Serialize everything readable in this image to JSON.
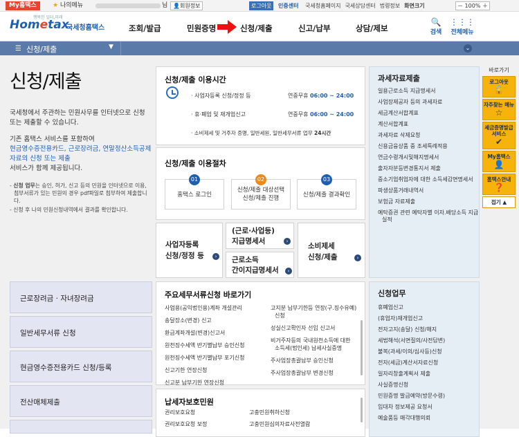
{
  "topbar": {
    "myhome": "My홈택스",
    "mymenu": "나의메뉴",
    "nim": "님",
    "userinfo": "회원정보",
    "logout": "로그아웃",
    "cert": "인증센터",
    "links": [
      "국세청홈페이지",
      "국세상담센터",
      "법령정보",
      "화면크기"
    ],
    "zoom": "100%"
  },
  "header": {
    "slogan": "행복한 일터,미래",
    "logo_pre": "Hom",
    "logo_e": "e",
    "logo_post": "tax",
    "logo_nts": "국세청홈택스",
    "nav": [
      "조회/발급",
      "민원증명",
      "신청/제출",
      "신고/납부",
      "상담/제보"
    ],
    "search": "검색",
    "allmenu": "전체메뉴"
  },
  "subbar": {
    "title": "신청/제출"
  },
  "intro": {
    "title": "신청/제출",
    "p1": "국세청에서 주관하는 민원사무를 인터넷으로 신청 또는 제출할 수 있습니다.",
    "p2a": "기존 홈택스 서비스를 포함하여",
    "p2b": "현금영수증전용카드, 근로장려금, 연말정산소득공제자료의 신청 또는 제출",
    "p2c": "서비스가 함께 제공됩니다.",
    "note1_b": "신청 업무",
    "note1": "는 승인, 허가, 신고 등의 민원을 인터넷으로 이용, 첨부서류가 있는 민원의 경우 pdf파일로 첨부하여 제출합니다.",
    "note2": "신청 후 나의 민원신청내역에서 결과를 확인합니다."
  },
  "hours": {
    "title": "신청/제출 이용시간",
    "rows": [
      {
        "label": "· 사업자등록 신청/정정 등",
        "range": "연중무휴",
        "time": "06:00 ~ 24:00"
      },
      {
        "label": "· 휴·폐업 및 재개업신고",
        "range": "연중무휴",
        "time": "06:00 ~ 24:00"
      },
      {
        "label": "· 소비제세 및 거주자 증명, 일반세원, 일반세무서류 업무",
        "range": "",
        "time": "24시간"
      }
    ]
  },
  "procedure": {
    "title": "신청/제출 이용절차",
    "steps": [
      {
        "num": "01",
        "l1": "홈택스 로그인",
        "l2": ""
      },
      {
        "num": "02",
        "l1": "신청/제출 대상선택",
        "l2": "신청/제출 진행"
      },
      {
        "num": "03",
        "l1": "신청/제출 결과확인",
        "l2": ""
      }
    ]
  },
  "boxes": {
    "biz_l1": "사업자등록",
    "biz_l2": "신청/정정 등",
    "pay_l1": "(근로·사업등)",
    "pay_l2": "지급명세서",
    "simple_l1": "근로소득",
    "simple_l2": "간이지급명세서",
    "cons_l1": "소비제세",
    "cons_l2": "신청/제출"
  },
  "left_buttons": [
    "근로장려금 · 자녀장려금",
    "일반세무서류 신청",
    "현금영수증전용카드 신청/등록",
    "전산매체제출"
  ],
  "major": {
    "title": "주요세무서류신청 바로가기",
    "col1": [
      "사업용(공익법인용)계좌 개설관리",
      "송달장소(변경) 신고",
      "환급계좌개설(변경)신고서",
      "원천징수세액 반기별납부 승인신청",
      "원천징수세액 반기별납부 포기신청",
      "신고기한 연장신청",
      "신고분 납부기한 연장신청"
    ],
    "col2": [
      "고지분 납부기한등 연장(구.징수유예) 신청",
      "성실신고확인자 선임 신고서",
      "비거주자등의 국내원천소득에 대한 소득세(법인세) 납세사실증명",
      "주사업장총괄납부 승인신청",
      "주사업장총괄납부 변경신청"
    ]
  },
  "protect": {
    "title": "납세자보호민원",
    "col1": [
      "권리보호요청",
      "권리보호요청 보정"
    ],
    "col2": [
      "고충민원취하신청",
      "고충민원심의자료사전열람"
    ]
  },
  "taxdata": {
    "title": "과세자료제출",
    "items": [
      "일용근로소득 지급명세서",
      "사업장제공자 등의 과세자료",
      "세금계산서합계표",
      "계산서합계표",
      "과세자료 삭제요청",
      "신용금융상품 중 조세특례적용",
      "연금수령개시및해지명세서",
      "출자자분등변경통지서 제출",
      "중소기업취업자에 대한 소득세감면명세서",
      "파생상품거래내역서",
      "보험금 자료제출",
      "예탁증권 관련 예탁자별 이자.배당소득 지급 실적"
    ]
  },
  "apply": {
    "title": "신청업무",
    "items": [
      "휴폐업신고",
      "(휴업자)재개업신고",
      "전자고지(송달) 신청/해지",
      "세법해석(서면질의/사전답변)",
      "불복(과세/이의/심사등)신청",
      "전자(세금)계산서자료신청",
      "일자리창출계획서 제출",
      "사실증명신청",
      "민원증명 발급예약(방문수령)",
      "임대차 정보제공 요청서",
      "예술품등 매각대행의뢰"
    ]
  },
  "side": {
    "head": "바로가기",
    "items": [
      {
        "label": "로그아웃",
        "icon": "🔓"
      },
      {
        "label": "자주찾는 메뉴",
        "icon": "☆"
      },
      {
        "label": "세금증명발급서비스",
        "icon": "✔"
      },
      {
        "label": "My홈택스",
        "icon": "👤"
      },
      {
        "label": "홈택스안내",
        "icon": "❓"
      }
    ],
    "close": "접기 ▲"
  }
}
